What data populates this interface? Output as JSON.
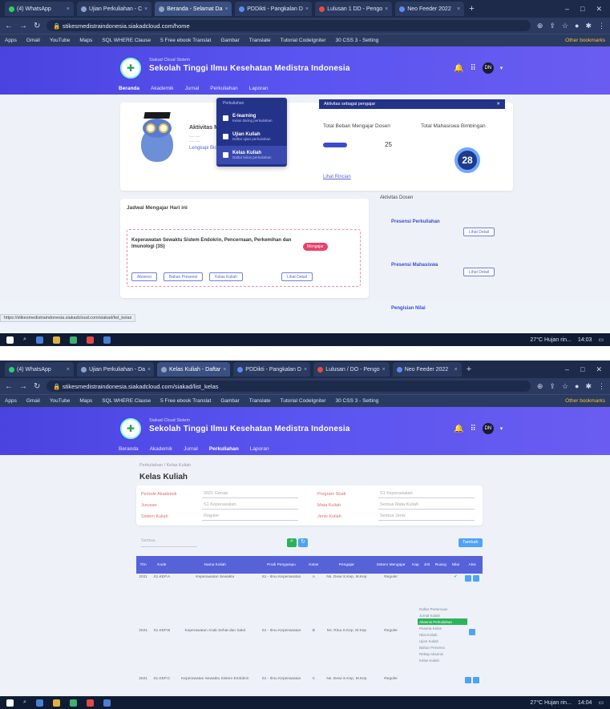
{
  "shot1": {
    "tabs": [
      {
        "label": "(4) WhatsApp",
        "active": false
      },
      {
        "label": "Ujian Perkuliahan - C",
        "active": false
      },
      {
        "label": "Beranda - Selamat Da",
        "active": true
      },
      {
        "label": "PDDikti - Pangkalan D",
        "active": false
      },
      {
        "label": "Lulusan 1 DD - Pengo",
        "active": false
      },
      {
        "label": "Neo Feeder 2022",
        "active": false
      }
    ],
    "url": "stikesmedistraindonesia.siakadcloud.com/home",
    "bookmarks": [
      "Apps",
      "Gmail",
      "YouTube",
      "Maps",
      "SQL WHERE Clause",
      "5 Free ebook Translat",
      "Gambar",
      "Translate",
      "Tutorial CodeIgniter",
      "30 CSS 3 - Setting"
    ],
    "other_bookmarks": "Other bookmarks",
    "header": {
      "system": "Siakad Cloud Sistem",
      "institution": "Sekolah Tinggi Ilmu Kesehatan Medistra Indonesia",
      "avatar_initials": "DN"
    },
    "menu": [
      "Beranda",
      "Akademik",
      "Jurnal",
      "Perkuliahan",
      "Laporan"
    ],
    "dropdown": {
      "heading": "Perkuliahan",
      "items": [
        {
          "title": "E-learning",
          "sub": "Kelas daring perkuliahan"
        },
        {
          "title": "Ujian Kuliah",
          "sub": "Daftar ujian perkuliahan"
        },
        {
          "title": "Kelas Kuliah",
          "sub": "Daftar kelas perkuliahan"
        }
      ]
    },
    "notice": "Aktivitas sebagai pengajar",
    "activity_title": "Aktivitas M",
    "activity_link": "Lengkapi Biodata",
    "teaching_title": "Total Beban Mengajar Dosen",
    "teaching_value": "25",
    "teaching_link": "Lihat Rincian",
    "guidance_title": "Total Mahasiswa Bimbingan",
    "guidance_value": "28",
    "schedule_title": "Jadwal Mengajar Hari ini",
    "course_title": "Keperawatan Sewaktu Sistem Endokrin, Pencernaan, Perkemihan dan Imunologi (3S)",
    "course_badge": "Mengajar",
    "course_buttons": [
      "Absensi",
      "Bahan Presensi",
      "Kelas Kuliah",
      "Lihat Detail"
    ],
    "activity_panel": "Aktivitas Dosen",
    "activity_items": [
      {
        "title": "Presensi Perkuliahan",
        "action": "Lihat Detail"
      },
      {
        "title": "Presensi Mahasiswa",
        "action": "Lihat Detail"
      },
      {
        "title": "Pengisian Nilai",
        "action": ""
      }
    ],
    "status_url": "https://stikesmedistraindonesia.siakadcloud.com/siakad/list_kelas",
    "weather": "27°C Hujan rin...",
    "time": "14:03"
  },
  "shot2": {
    "tabs": [
      {
        "label": "(4) WhatsApp",
        "active": false
      },
      {
        "label": "Ujian Perkuliahan - Da",
        "active": false
      },
      {
        "label": "Kelas Kuliah - Daftar",
        "active": true
      },
      {
        "label": "PDDikti - Pangkalan D",
        "active": false
      },
      {
        "label": "Lulusan / DO - Pengo",
        "active": false
      },
      {
        "label": "Neo Feeder 2022",
        "active": false
      }
    ],
    "url": "stikesmedistraindonesia.siakadcloud.com/siakad/list_kelas",
    "breadcrumb": "Perkuliahan  /  Kelas Kuliah",
    "page_title": "Kelas Kuliah",
    "filters": [
      {
        "label": "Periode Akademik",
        "value": "2021 Genap"
      },
      {
        "label": "Jurusan",
        "value": "S1 Keperawatan"
      },
      {
        "label": "Sistem Kuliah",
        "value": "Reguler"
      },
      {
        "label": "Program Studi",
        "value": "S1 Keperawatan"
      },
      {
        "label": "Mata Kuliah",
        "value": "Semua Mata Kuliah"
      },
      {
        "label": "Jenis Kuliah",
        "value": "Semua Jenis"
      }
    ],
    "search_placeholder": "Semua",
    "add_button": "Tambah",
    "columns": [
      "Thn",
      "Kode",
      "Nama Kuliah",
      "Prodi Pengampu",
      "Kelas",
      "Pengajar",
      "Sistem Mengajar",
      "Kap",
      "Jml",
      "Ruang",
      "Nilai",
      "Aksi"
    ],
    "rows": [
      {
        "thn": "2021",
        "kode": "S1.KEP.A",
        "nama": "Keperawatan Sewaktu",
        "prodi": "S1 - Ilmu Keperawatan",
        "kelas": "A",
        "pengajar": "Ns. Dewi S.Kep, M.Kep",
        "sistem": "Reguler"
      },
      {
        "thn": "2021",
        "kode": "S1.KEP.B",
        "nama": "Keperawatan Anak Sehat dan Sakit",
        "prodi": "S1 - Ilmu Keperawatan",
        "kelas": "B",
        "pengajar": "Ns. Rina S.Kep, M.Kep",
        "sistem": "Reguler"
      },
      {
        "thn": "2021",
        "kode": "S1.KEP.C",
        "nama": "Keperawatan Sewaktu Sistem Endokrin",
        "prodi": "S1 - Ilmu Keperawatan",
        "kelas": "C",
        "pengajar": "Ns. Dewi S.Kep, M.Kep",
        "sistem": "Reguler"
      }
    ],
    "row_menu": [
      "Daftar Pertemuan",
      "Jurnal Kuliah",
      "Absensi Perkuliahan",
      "Peserta Kelas",
      "Nilai Kuliah",
      "Ujian Kuliah",
      "Bahan Presensi",
      "Rekap Absensi",
      "Kelas Kuliah"
    ],
    "row_menu_highlight": 2,
    "weather": "27°C Hujan rin...",
    "time": "14:04"
  },
  "colors": {
    "header": "#4a43e0",
    "menu_highlight": "#2bb35b",
    "table_header": "#5562d8",
    "danger": "#e8416a"
  }
}
